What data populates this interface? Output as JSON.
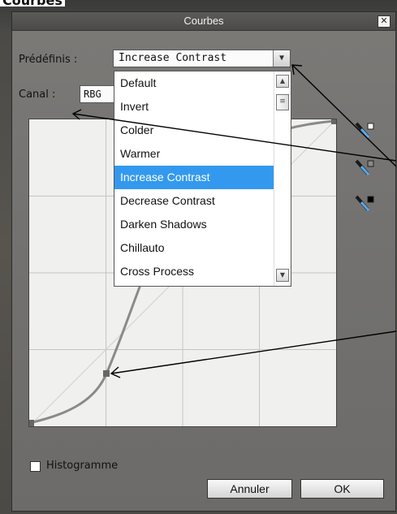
{
  "page_fragment": "Courbes",
  "dialog": {
    "title": "Courbes",
    "close_glyph": "✕"
  },
  "presets": {
    "label": "Prédéfinis :",
    "selected": "Increase Contrast",
    "options": [
      "Default",
      "Invert",
      "Colder",
      "Warmer",
      "Increase Contrast",
      "Decrease Contrast",
      "Darken Shadows",
      "Chillauto",
      "Cross Process"
    ],
    "highlighted": "Increase Contrast"
  },
  "channel": {
    "label": "Canal :",
    "value": "RBG"
  },
  "histogram": {
    "label": "Histogramme",
    "checked": false
  },
  "buttons": {
    "cancel": "Annuler",
    "ok": "OK"
  },
  "colors": {
    "selection": "#3399ee",
    "dialog_bg": "#727170",
    "curve": "#8a8a8a"
  },
  "icons": [
    "eyedropper-white-icon",
    "eyedropper-gray-icon",
    "eyedropper-black-icon",
    "dropdown-arrow-icon",
    "scroll-up-icon",
    "scroll-down-icon",
    "close-icon"
  ]
}
